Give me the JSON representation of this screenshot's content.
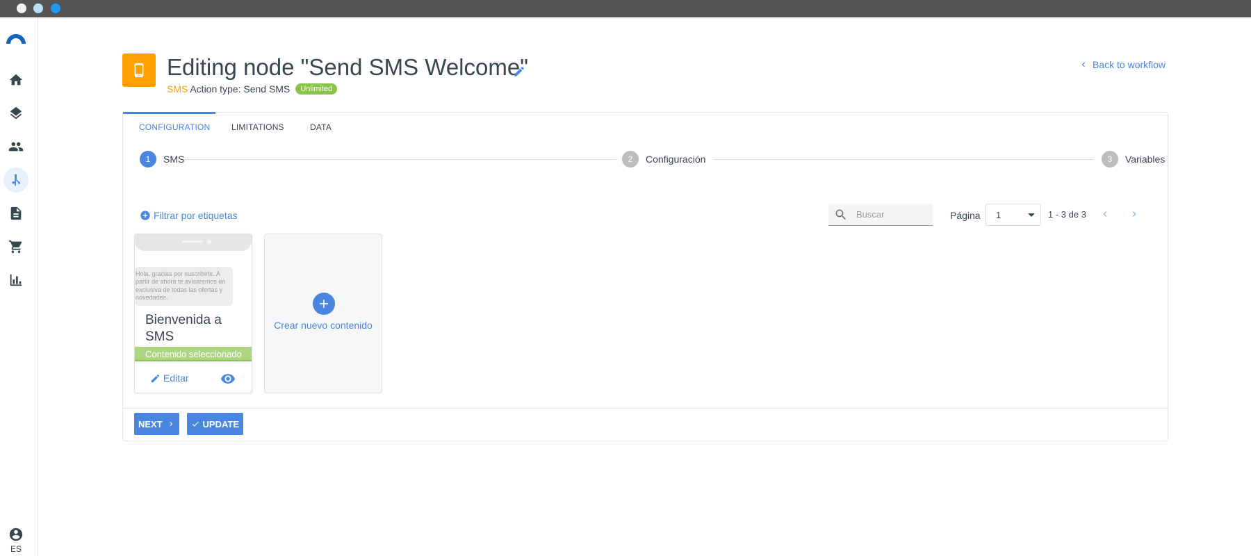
{
  "sidebar": {
    "items": [
      {
        "name": "home",
        "icon": "home-icon"
      },
      {
        "name": "layers",
        "icon": "layers-icon"
      },
      {
        "name": "contacts",
        "icon": "people-icon"
      },
      {
        "name": "workflows",
        "icon": "workflow-icon",
        "active": true
      },
      {
        "name": "documents",
        "icon": "document-icon"
      },
      {
        "name": "shop",
        "icon": "cart-icon"
      },
      {
        "name": "analytics",
        "icon": "bar-chart-icon"
      }
    ],
    "language": "ES"
  },
  "header": {
    "title": "Editing node \"Send SMS Welcome\"",
    "channel": "SMS",
    "action_type": "Action type: Send SMS",
    "badge": "Unlimited",
    "back_link": "Back to workflow"
  },
  "tabs": [
    {
      "label": "CONFIGURATION",
      "active": true
    },
    {
      "label": "LIMITATIONS",
      "active": false
    },
    {
      "label": "DATA",
      "active": false
    }
  ],
  "stepper": [
    {
      "number": "1",
      "label": "SMS",
      "active": true
    },
    {
      "number": "2",
      "label": "Configuración",
      "active": false
    },
    {
      "number": "3",
      "label": "Variables",
      "active": false
    }
  ],
  "toolbar": {
    "filter_label": "Filtrar por etiquetas",
    "search_placeholder": "Buscar",
    "page_label": "Página",
    "page_value": "1",
    "range": "1 - 3 de 3"
  },
  "contents": [
    {
      "preview_text": "Hola, gracias por suscribirte. A partir de ahora te avisaremos en exclusiva de todas las ofertas y novedades.",
      "title": "Bienvenida a SMS",
      "status": "Contenido seleccionado",
      "edit_label": "Editar"
    }
  ],
  "new_content_label": "Crear nuevo contenido",
  "buttons": {
    "next": "NEXT",
    "update": "UPDATE"
  },
  "colors": {
    "accent": "#4a86e0",
    "sms_orange": "#ffa000",
    "success_green": "#8bc34a"
  }
}
